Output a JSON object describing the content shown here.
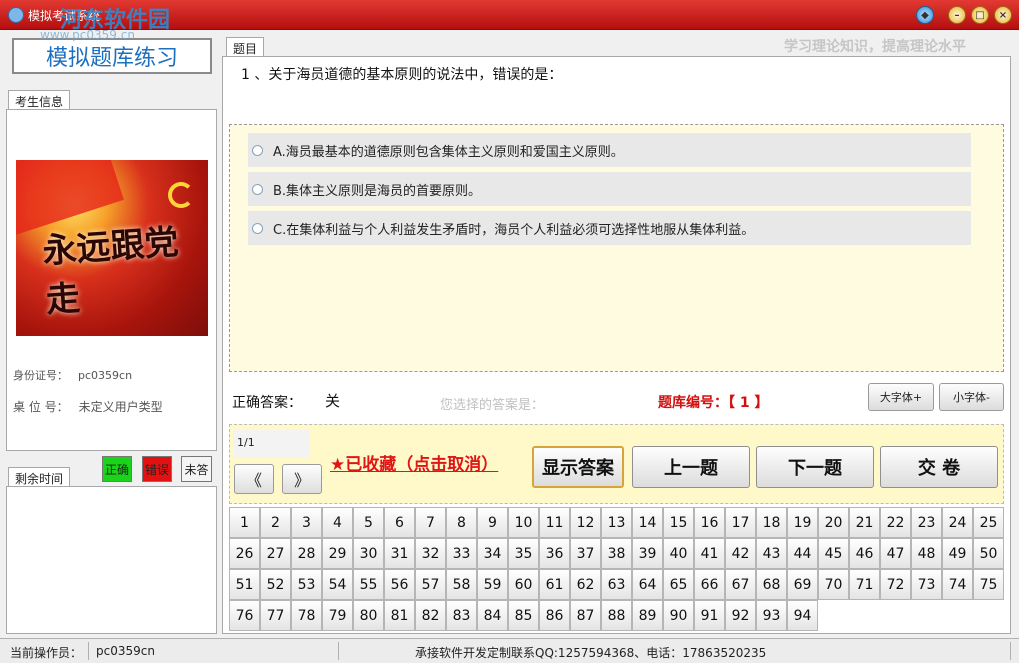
{
  "window": {
    "title": "模拟考试系统",
    "watermark": "河东软件园",
    "watermark_url": "www.pc0359.cn",
    "min_icon": "minimize-icon",
    "max_icon": "maximize-icon",
    "close_icon": "close-icon",
    "skin_icon": "skin-icon"
  },
  "brand": "模拟题库练习",
  "slogan": "学习理论知识，提高理论水平",
  "tabs": {
    "question": "题目",
    "candidate": "考生信息",
    "time": "剩余时间"
  },
  "candidate": {
    "photo_text": "永远跟党走",
    "id_label": "身份证号：",
    "id_value": "pc0359cn",
    "seat_label": "桌 位 号：",
    "seat_value": "未定义用户类型"
  },
  "marks": {
    "correct": "正确",
    "wrong": "错误",
    "unanswered": "未答",
    "correct_color": "#19d419",
    "wrong_color": "#e21212"
  },
  "question": {
    "number": "1",
    "text": "、关于海员道德的基本原则的说法中，错误的是：",
    "options": [
      "A.海员最基本的道德原则包含集体主义原则和爱国主义原则。",
      "B.集体主义原则是海员的首要原则。",
      "C.在集体利益与个人利益发生矛盾时，海员个人利益必须可选择性地服从集体利益。"
    ]
  },
  "answer": {
    "label": "正确答案：",
    "value": "关",
    "chosen_label": "您选择的答案是：",
    "bank_no": "题库编号：【 1 】"
  },
  "font": {
    "larger": "大字体+",
    "smaller": "小字体-"
  },
  "nav": {
    "counter": "1/1",
    "prev_arrow": "《",
    "next_arrow": "》",
    "favorite": "★已收藏（点击取消）",
    "show_answer": "显示答案",
    "prev": "上一题",
    "next": "下一题",
    "submit": "交 卷"
  },
  "question_grid": [
    1,
    2,
    3,
    4,
    5,
    6,
    7,
    8,
    9,
    10,
    11,
    12,
    13,
    14,
    15,
    16,
    17,
    18,
    19,
    20,
    21,
    22,
    23,
    24,
    25,
    26,
    27,
    28,
    29,
    30,
    31,
    32,
    33,
    34,
    35,
    36,
    37,
    38,
    39,
    40,
    41,
    42,
    43,
    44,
    45,
    46,
    47,
    48,
    49,
    50,
    51,
    52,
    53,
    54,
    55,
    56,
    57,
    58,
    59,
    60,
    61,
    62,
    63,
    64,
    65,
    66,
    67,
    68,
    69,
    70,
    71,
    72,
    73,
    74,
    75,
    76,
    77,
    78,
    79,
    80,
    81,
    82,
    83,
    84,
    85,
    86,
    87,
    88,
    89,
    90,
    91,
    92,
    93,
    94
  ],
  "status": {
    "operator_label": "当前操作员：",
    "operator": "pc0359cn",
    "contact": "承接软件开发定制联系QQ:1257594368、电话：17863520235"
  }
}
